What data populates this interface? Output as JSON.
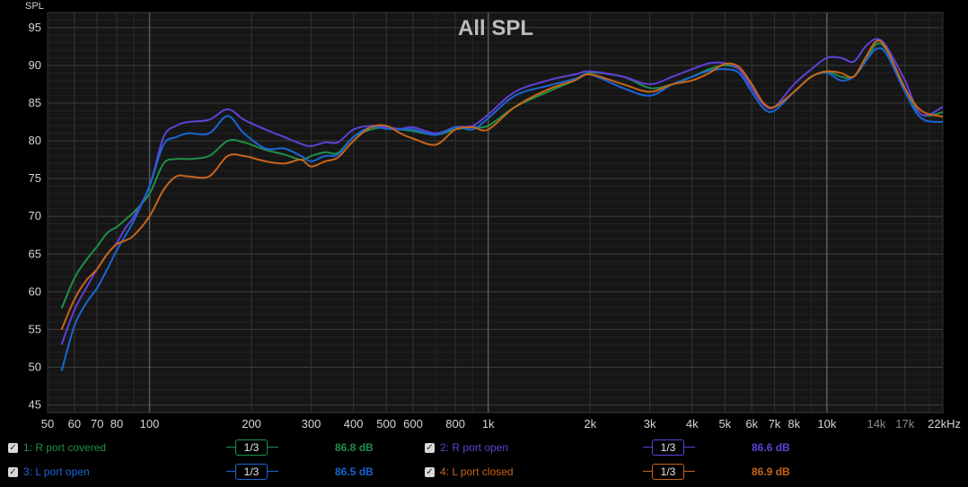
{
  "chart_data": {
    "type": "line",
    "title": "All SPL",
    "ylabel": "SPL",
    "xscale": "log",
    "xlim": [
      50,
      22000
    ],
    "ylim": [
      44,
      97
    ],
    "y_ticks": [
      "45",
      "50",
      "55",
      "60",
      "65",
      "70",
      "75",
      "80",
      "85",
      "90",
      "95"
    ],
    "x_ticks": [
      {
        "v": 50,
        "label": "50"
      },
      {
        "v": 60,
        "label": "60"
      },
      {
        "v": 70,
        "label": "70"
      },
      {
        "v": 80,
        "label": "80"
      },
      {
        "v": 100,
        "label": "100"
      },
      {
        "v": 200,
        "label": "200"
      },
      {
        "v": 300,
        "label": "300"
      },
      {
        "v": 400,
        "label": "400"
      },
      {
        "v": 500,
        "label": "500"
      },
      {
        "v": 600,
        "label": "600"
      },
      {
        "v": 800,
        "label": "800"
      },
      {
        "v": 1000,
        "label": "1k"
      },
      {
        "v": 2000,
        "label": "2k"
      },
      {
        "v": 3000,
        "label": "3k"
      },
      {
        "v": 4000,
        "label": "4k"
      },
      {
        "v": 5000,
        "label": "5k"
      },
      {
        "v": 6000,
        "label": "6k"
      },
      {
        "v": 7000,
        "label": "7k"
      },
      {
        "v": 8000,
        "label": "8k"
      },
      {
        "v": 10000,
        "label": "10k"
      },
      {
        "v": 14000,
        "label": "14k",
        "dim": true
      },
      {
        "v": 17000,
        "label": "17k",
        "dim": true
      },
      {
        "v": 22000,
        "label": "22kHz"
      }
    ],
    "series": [
      {
        "name": "1: R port covered",
        "color": "#1f8f4a",
        "smoothing": "1/3",
        "avg": "86.8 dB",
        "x": [
          55,
          60,
          65,
          70,
          75,
          80,
          85,
          90,
          100,
          110,
          120,
          130,
          150,
          170,
          190,
          220,
          250,
          280,
          300,
          330,
          360,
          400,
          450,
          500,
          550,
          600,
          700,
          800,
          900,
          1000,
          1200,
          1500,
          1800,
          2000,
          2500,
          3000,
          3500,
          4000,
          4500,
          5000,
          5500,
          6000,
          6500,
          7000,
          8000,
          9000,
          10000,
          11000,
          12000,
          13000,
          14000,
          15000,
          17000,
          19000,
          22000
        ],
        "y": [
          57.8,
          61.8,
          64.2,
          66.0,
          67.8,
          68.6,
          69.6,
          70.6,
          73.0,
          77.0,
          77.6,
          77.6,
          78.0,
          80.0,
          79.8,
          78.8,
          78.2,
          77.5,
          78.0,
          78.5,
          78.4,
          80.5,
          81.5,
          81.8,
          81.5,
          81.3,
          80.8,
          81.5,
          81.8,
          82.0,
          84.5,
          86.5,
          88.0,
          89.0,
          88.5,
          87.0,
          87.5,
          88.5,
          89.5,
          90.0,
          89.5,
          87.5,
          85.0,
          84.5,
          86.5,
          88.5,
          89.2,
          88.5,
          88.5,
          90.5,
          92.8,
          92.0,
          87.0,
          83.5,
          83.8
        ]
      },
      {
        "name": "2: R port open",
        "color": "#6040d8",
        "smoothing": "1/3",
        "avg": "86.6 dB",
        "x": [
          55,
          60,
          65,
          70,
          75,
          80,
          85,
          90,
          100,
          110,
          120,
          130,
          150,
          170,
          190,
          220,
          250,
          280,
          300,
          330,
          360,
          400,
          450,
          500,
          550,
          600,
          700,
          800,
          900,
          1000,
          1200,
          1500,
          1800,
          2000,
          2500,
          3000,
          3500,
          4000,
          4500,
          5000,
          5500,
          6000,
          6500,
          7000,
          8000,
          9000,
          10000,
          11000,
          12000,
          13000,
          14000,
          15000,
          17000,
          19000,
          22000
        ],
        "y": [
          53.0,
          57.6,
          60.5,
          63.0,
          65.0,
          66.5,
          68.5,
          70.0,
          74.0,
          80.5,
          82.0,
          82.5,
          82.8,
          84.2,
          82.8,
          81.5,
          80.5,
          79.6,
          79.3,
          79.8,
          79.8,
          81.5,
          82.0,
          81.8,
          81.6,
          81.8,
          81.0,
          81.8,
          82.0,
          83.5,
          86.5,
          88.0,
          88.8,
          89.2,
          88.5,
          87.5,
          88.5,
          89.5,
          90.3,
          90.3,
          89.5,
          87.0,
          84.8,
          84.5,
          87.5,
          89.5,
          91.0,
          91.0,
          90.5,
          92.5,
          93.5,
          92.5,
          88.0,
          83.5,
          84.5
        ]
      },
      {
        "name": "3: L port open",
        "color": "#1a66d4",
        "smoothing": "1/3",
        "avg": "86.5 dB",
        "x": [
          55,
          60,
          65,
          70,
          75,
          80,
          85,
          90,
          100,
          110,
          120,
          130,
          150,
          170,
          190,
          220,
          250,
          280,
          300,
          330,
          360,
          400,
          450,
          500,
          550,
          600,
          700,
          800,
          900,
          1000,
          1200,
          1500,
          1800,
          2000,
          2500,
          3000,
          3500,
          4000,
          4500,
          5000,
          5500,
          6000,
          6500,
          7000,
          8000,
          9000,
          10000,
          11000,
          12000,
          13000,
          14000,
          15000,
          17000,
          19000,
          22000
        ],
        "y": [
          49.5,
          55.5,
          58.5,
          60.5,
          63.0,
          65.5,
          67.5,
          69.5,
          74.0,
          79.5,
          80.5,
          81.0,
          81.0,
          83.3,
          81.0,
          79.0,
          79.0,
          78.0,
          77.3,
          78.0,
          78.2,
          80.5,
          81.8,
          81.6,
          81.5,
          81.5,
          80.8,
          81.8,
          81.5,
          83.0,
          86.0,
          87.3,
          88.2,
          88.8,
          87.0,
          86.0,
          87.5,
          88.5,
          89.3,
          89.5,
          89.0,
          86.5,
          84.3,
          84.0,
          86.5,
          88.5,
          89.0,
          88.0,
          88.5,
          90.5,
          92.2,
          91.5,
          86.5,
          83.0,
          82.5
        ]
      },
      {
        "name": "4: L port closed",
        "color": "#c8651a",
        "smoothing": "1/3",
        "avg": "86.9 dB",
        "x": [
          55,
          60,
          65,
          70,
          75,
          80,
          85,
          90,
          100,
          110,
          120,
          130,
          150,
          170,
          190,
          220,
          250,
          280,
          300,
          330,
          360,
          400,
          450,
          500,
          550,
          600,
          700,
          800,
          900,
          1000,
          1200,
          1500,
          1800,
          2000,
          2500,
          3000,
          3500,
          4000,
          4500,
          5000,
          5500,
          6000,
          6500,
          7000,
          8000,
          9000,
          10000,
          11000,
          12000,
          13000,
          14000,
          15000,
          17000,
          19000,
          22000
        ],
        "y": [
          55.0,
          59.0,
          61.5,
          63.0,
          65.0,
          66.3,
          66.8,
          67.5,
          70.0,
          73.5,
          75.3,
          75.3,
          75.3,
          78.0,
          78.0,
          77.3,
          77.0,
          77.5,
          76.6,
          77.3,
          77.8,
          80.0,
          81.8,
          82.0,
          81.0,
          80.3,
          79.5,
          81.5,
          81.8,
          81.5,
          84.5,
          86.8,
          88.0,
          88.8,
          87.5,
          86.5,
          87.5,
          88.0,
          89.0,
          90.2,
          89.8,
          87.5,
          85.0,
          84.5,
          86.5,
          88.5,
          89.2,
          89.0,
          88.5,
          91.0,
          93.2,
          92.2,
          87.0,
          84.0,
          83.2
        ]
      }
    ]
  },
  "legend": [
    {
      "label": "1: R port covered",
      "smoothing": "1/3",
      "avg": "86.8 dB",
      "color": "#1f8f4a"
    },
    {
      "label": "2: R port open",
      "smoothing": "1/3",
      "avg": "86.6 dB",
      "color": "#6040d8"
    },
    {
      "label": "3: L port open",
      "smoothing": "1/3",
      "avg": "86.5 dB",
      "color": "#1a66d4"
    },
    {
      "label": "4: L port closed",
      "smoothing": "1/3",
      "avg": "86.9 dB",
      "color": "#c8651a"
    }
  ]
}
